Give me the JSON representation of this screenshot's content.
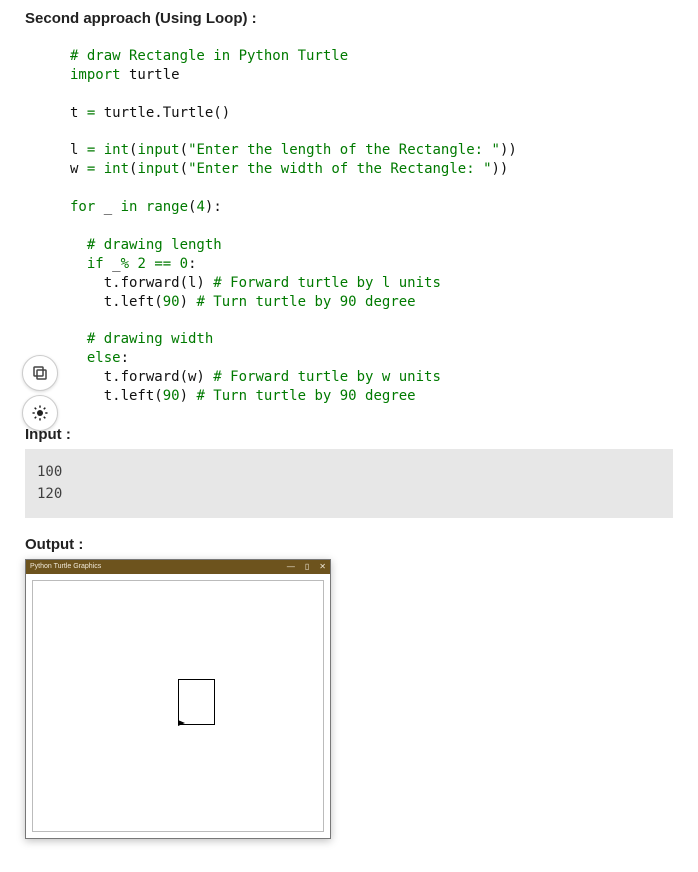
{
  "heading": "Second approach (Using Loop) :",
  "code": {
    "l01": "# draw Rectangle in Python Turtle",
    "l02a": "import",
    "l02b": " turtle",
    "l03a": "t ",
    "l03b": "=",
    "l03c": " turtle.Turtle()",
    "l04a": "l ",
    "l04b": "=",
    "l04c": " ",
    "l04d": "int",
    "l04e": "(",
    "l04f": "input",
    "l04g": "(",
    "l04h": "\"Enter the length of the Rectangle: \"",
    "l04i": "))",
    "l05a": "w ",
    "l05b": "=",
    "l05c": " ",
    "l05d": "int",
    "l05e": "(",
    "l05f": "input",
    "l05g": "(",
    "l05h": "\"Enter the width of the Rectangle: \"",
    "l05i": "))",
    "l06a": "for",
    "l06b": " _ ",
    "l06c": "in",
    "l06d": " ",
    "l06e": "range",
    "l06f": "(",
    "l06g": "4",
    "l06h": "):",
    "l07": "# drawing length",
    "l08a": "if",
    "l08b": " _",
    "l08c": "%",
    "l08d": " ",
    "l08e": "2",
    "l08f": " ",
    "l08g": "==",
    "l08h": " ",
    "l08i": "0",
    "l08j": ":",
    "l09a": "t.forward(l) ",
    "l09b": "# Forward turtle by l units",
    "l10a": "t.left(",
    "l10b": "90",
    "l10c": ") ",
    "l10d": "# Turn turtle by 90 degree",
    "l11": "# drawing width",
    "l12a": "else",
    "l12b": ":",
    "l13a": "t.forward(w) ",
    "l13b": "# Forward turtle by w units",
    "l14a": "t.left(",
    "l14b": "90",
    "l14c": ") ",
    "l14d": "# Turn turtle by 90 degree"
  },
  "input_label": "Input :",
  "input_lines": {
    "l1": "100",
    "l2": "120"
  },
  "output_label": "Output :",
  "window": {
    "title": "Python Turtle Graphics",
    "minimize": "—",
    "maximize": "▯",
    "close": "✕"
  }
}
